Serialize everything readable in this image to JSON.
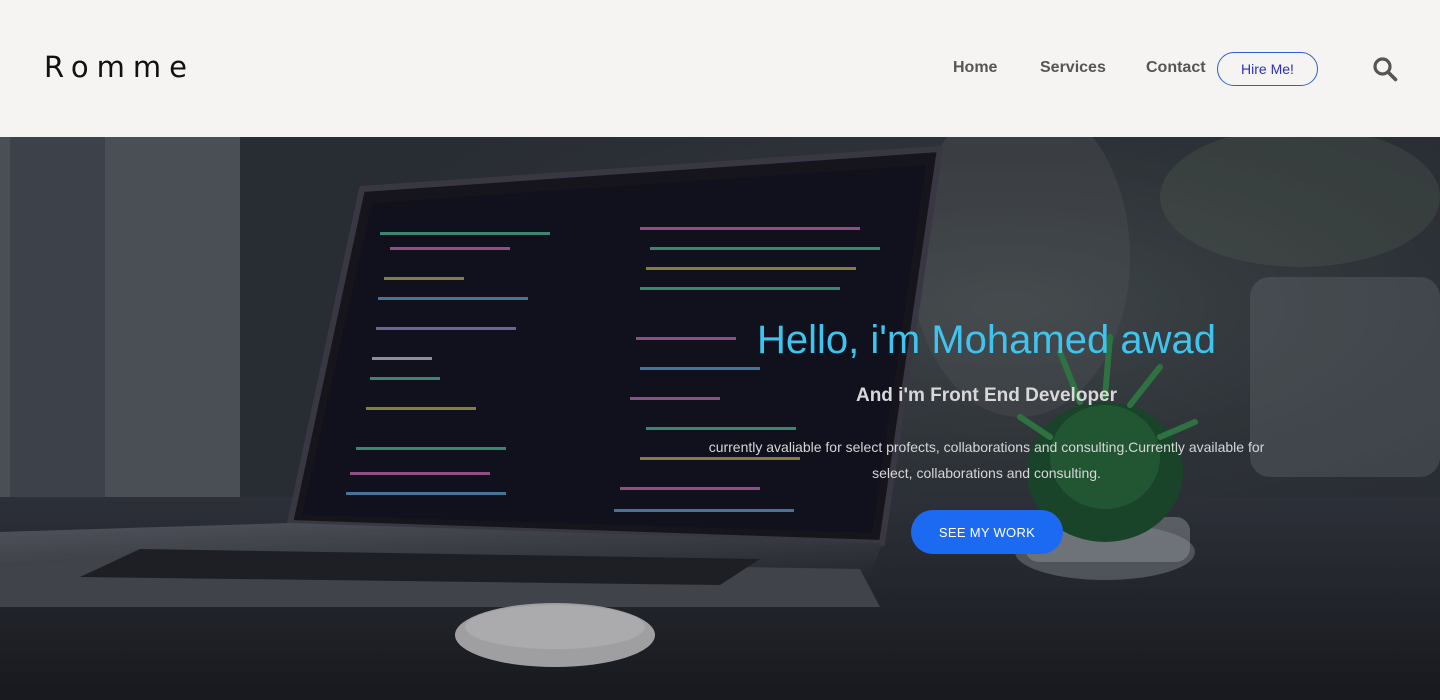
{
  "header": {
    "brand": "Romme",
    "nav": {
      "home": "Home",
      "services": "Services",
      "contact": "Contact"
    },
    "hire_label": "Hire Me!",
    "search_icon": "search-icon"
  },
  "hero": {
    "title": "Hello, i'm Mohamed awad",
    "subtitle": "And i'm Front End Developer",
    "description": "currently avaliable for select profects, collaborations and consulting.Currently available for select, collaborations and consulting.",
    "cta_label": "SEE MY WORK",
    "background_image": "laptop-with-code-image"
  },
  "colors": {
    "accent": "#3fc4ef",
    "button": "#1d6af2",
    "header_bg": "#f5f4f2"
  }
}
